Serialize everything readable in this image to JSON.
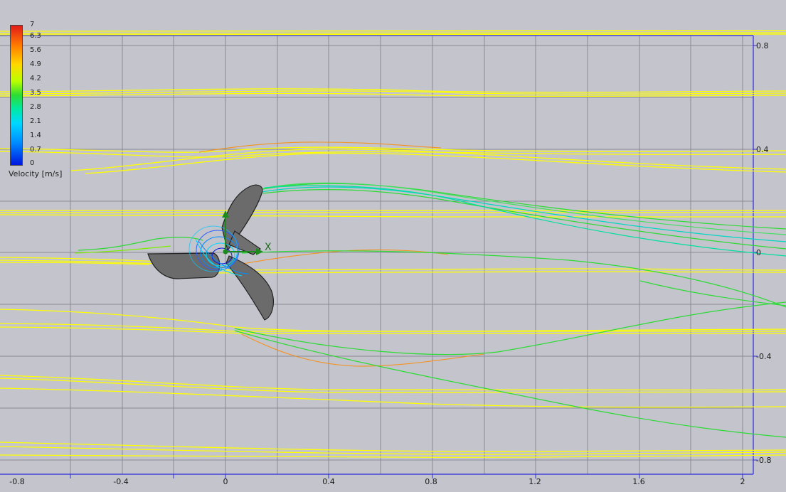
{
  "legend": {
    "title": "Velocity [m/s]",
    "ticks": [
      "7",
      "6.3",
      "5.6",
      "4.9",
      "4.2",
      "3.5",
      "2.8",
      "2.1",
      "1.4",
      "0.7",
      "0"
    ]
  },
  "x_axis": {
    "ticks": [
      "-0.8",
      "-0.4",
      "0",
      "0.4",
      "0.8",
      "1.2",
      "1.6",
      "2"
    ]
  },
  "y_axis": {
    "ticks": [
      "0.8",
      "0.4",
      "0",
      "-0.4",
      "-0.8"
    ]
  },
  "origin_axis_label": "X",
  "colors": {
    "background": "#c3c4cc",
    "grid": "#8a8a96",
    "frame": "#2b2bd8",
    "blade": "#6b6b6b",
    "streamline_fast": "#ffff00",
    "streamline_mid": "#2cdb34",
    "streamline_slow": "#00c8ff",
    "streamline_accel": "#ff8a00"
  }
}
